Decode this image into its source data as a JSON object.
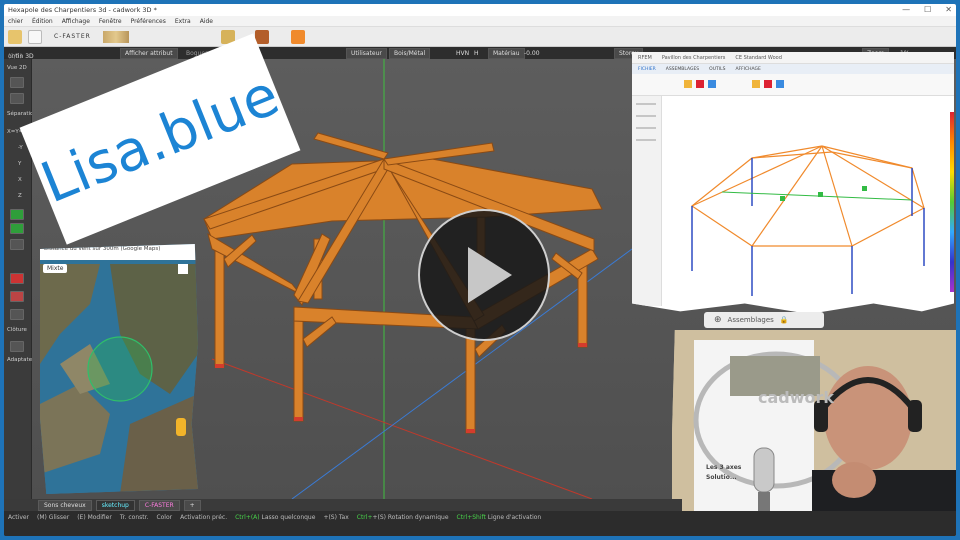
{
  "window": {
    "title": "Hexapole des Charpentiers 3d - cadwork 3D *",
    "controls": [
      "—",
      "☐",
      "✕"
    ]
  },
  "menu": [
    "chier",
    "Édition",
    "Affichage",
    "Fenêtre",
    "Préférences",
    "Extra",
    "Aide"
  ],
  "toolbar": {
    "logo_text": "C-FASTER",
    "afficher_attribut": "Afficher attribut",
    "bogues": "Bogues 3D",
    "utilisateur": "Utilisateur",
    "utilisateur_value": "Bois/Métal",
    "hvn_label": "HVN",
    "hvn_value": "H",
    "materiau_label": "Matériau",
    "materiau_value": "-0.00",
    "storey_label": "Storey",
    "storey_value": "Storey",
    "zoom_label": "Zoom",
    "zoom_value": "1%",
    "left_field": "ontin 3D",
    "left_field_hint": "(1/1)"
  },
  "left_panel": {
    "labels": [
      "Vue 2D",
      "Séparation",
      "X=Y=Z",
      "-Y",
      "Y",
      "X",
      "Z",
      "Clôture",
      "Jalousie",
      "Adaptateur"
    ]
  },
  "sticker": {
    "text": "Lisa.blue",
    "color": "#1c84d4"
  },
  "map": {
    "header": "Distance du vent sur 300m (Google Maps)",
    "mode": "Mixte"
  },
  "rfem": {
    "title_items": [
      "RFEM",
      "Pavillon des Charpentiers",
      "CE Standard Wood",
      "RFEM"
    ],
    "tabs": [
      "FICHIER",
      "ASSEMBLAGES",
      "OUTILS",
      "AFFICHAGE"
    ],
    "side_items": [
      "Projet",
      "Modèle",
      "Données",
      "Barres",
      "Charges",
      "Résultats"
    ]
  },
  "assemblages": {
    "label": "Assemblages",
    "lock_icon": "lock-icon"
  },
  "tabs": [
    {
      "label": "Sons cheveux",
      "state": "normal"
    },
    {
      "label": "sketchup",
      "state": "active"
    },
    {
      "label": "C-FASTER",
      "state": "magenta"
    },
    {
      "label": "+",
      "state": "normal"
    }
  ],
  "status": [
    {
      "key": "",
      "text": "Activer"
    },
    {
      "key": "",
      "text": "(M) Glisser"
    },
    {
      "key": "",
      "text": "(E) Modifier"
    },
    {
      "key": "",
      "text": "Tr. constr."
    },
    {
      "key": "",
      "text": "Color"
    },
    {
      "key": "",
      "text": "Activation préc."
    },
    {
      "key": "Ctrl+(A)",
      "text": "Lasso quelconque"
    },
    {
      "key": "",
      "text": "+(S) Tax"
    },
    {
      "key": "Ctrl+",
      "text": "+(S) Rotation dynamique"
    },
    {
      "key": "Ctrl+Shift",
      "text": "Ligne d'activation"
    }
  ],
  "webcam": {
    "poster_line1": "Les 3 axes",
    "poster_line2": "Solutio...",
    "poster_logo": "cadwork"
  },
  "colors": {
    "background": "#1e73b8",
    "viewport": "#555555",
    "timber": "#d9822b",
    "timber_dark": "#b7651b",
    "accent_green": "#48d24a"
  }
}
